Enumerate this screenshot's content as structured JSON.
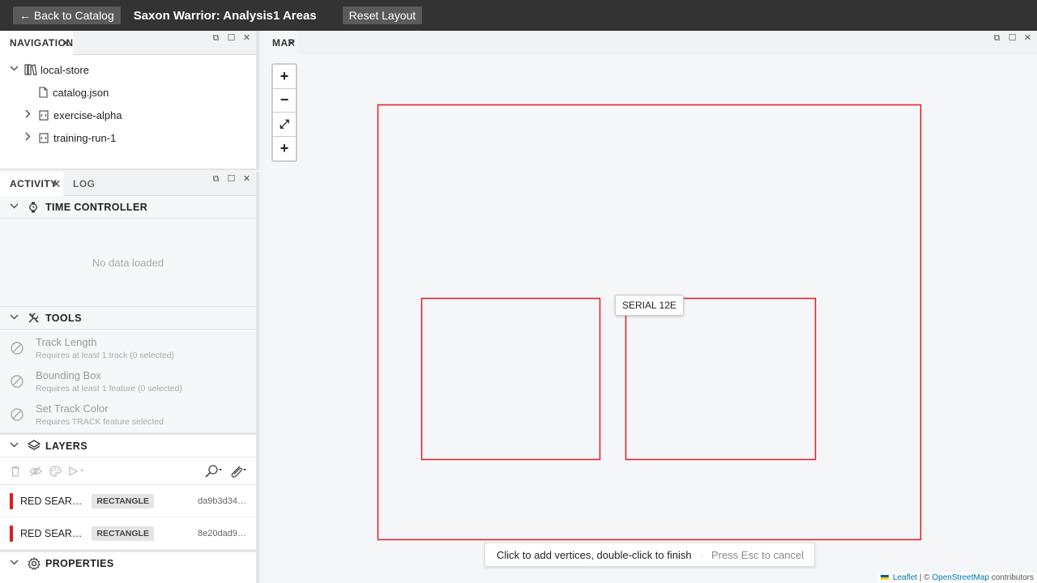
{
  "header": {
    "back_label": "← Back to Catalog",
    "title": "Saxon Warrior: Analysis1 Areas",
    "reset_label": "Reset Layout"
  },
  "navigation": {
    "tab_label": "NAVIGATION",
    "tree": [
      {
        "label": "local-store",
        "icon": "library-icon",
        "expanded": true
      },
      {
        "label": "catalog.json",
        "icon": "file-icon"
      },
      {
        "label": "exercise-alpha",
        "icon": "collection-icon",
        "expanded": false
      },
      {
        "label": "training-run-1",
        "icon": "collection-icon",
        "expanded": false
      }
    ]
  },
  "activity": {
    "tabs": [
      "ACTIVITY",
      "LOG"
    ],
    "time_controller": {
      "title": "TIME CONTROLLER",
      "empty_text": "No data loaded"
    },
    "tools": {
      "title": "TOOLS",
      "items": [
        {
          "title": "Track Length",
          "subtitle": "Requires at least 1 track (0 selected)"
        },
        {
          "title": "Bounding Box",
          "subtitle": "Requires at least 1 feature (0 selected)"
        },
        {
          "title": "Set Track Color",
          "subtitle": "Requires TRACK feature selected"
        }
      ]
    },
    "layers": {
      "title": "LAYERS",
      "rows": [
        {
          "name": "RED SEAR…",
          "type": "RECTANGLE",
          "id": "da9b3d34…",
          "color": "#e01b24"
        },
        {
          "name": "RED SEAR…",
          "type": "RECTANGLE",
          "id": "8e20dad9…",
          "color": "#e01b24"
        }
      ]
    },
    "properties": {
      "title": "PROPERTIES"
    }
  },
  "map": {
    "tab_label": "MAP",
    "zoom": {
      "in": "+",
      "out": "−",
      "fit": "⤢",
      "add": "+"
    },
    "tooltip": "SERIAL 12E",
    "hint_text": "Click to add vertices, double-click to finish",
    "hint_sep": "·",
    "hint_esc": "Press Esc to cancel",
    "attribution": {
      "leaflet": "Leaflet",
      "sep": " | © ",
      "osm": "OpenStreetMap",
      "suffix": " contributors"
    },
    "shape_color": "#e01b24"
  }
}
